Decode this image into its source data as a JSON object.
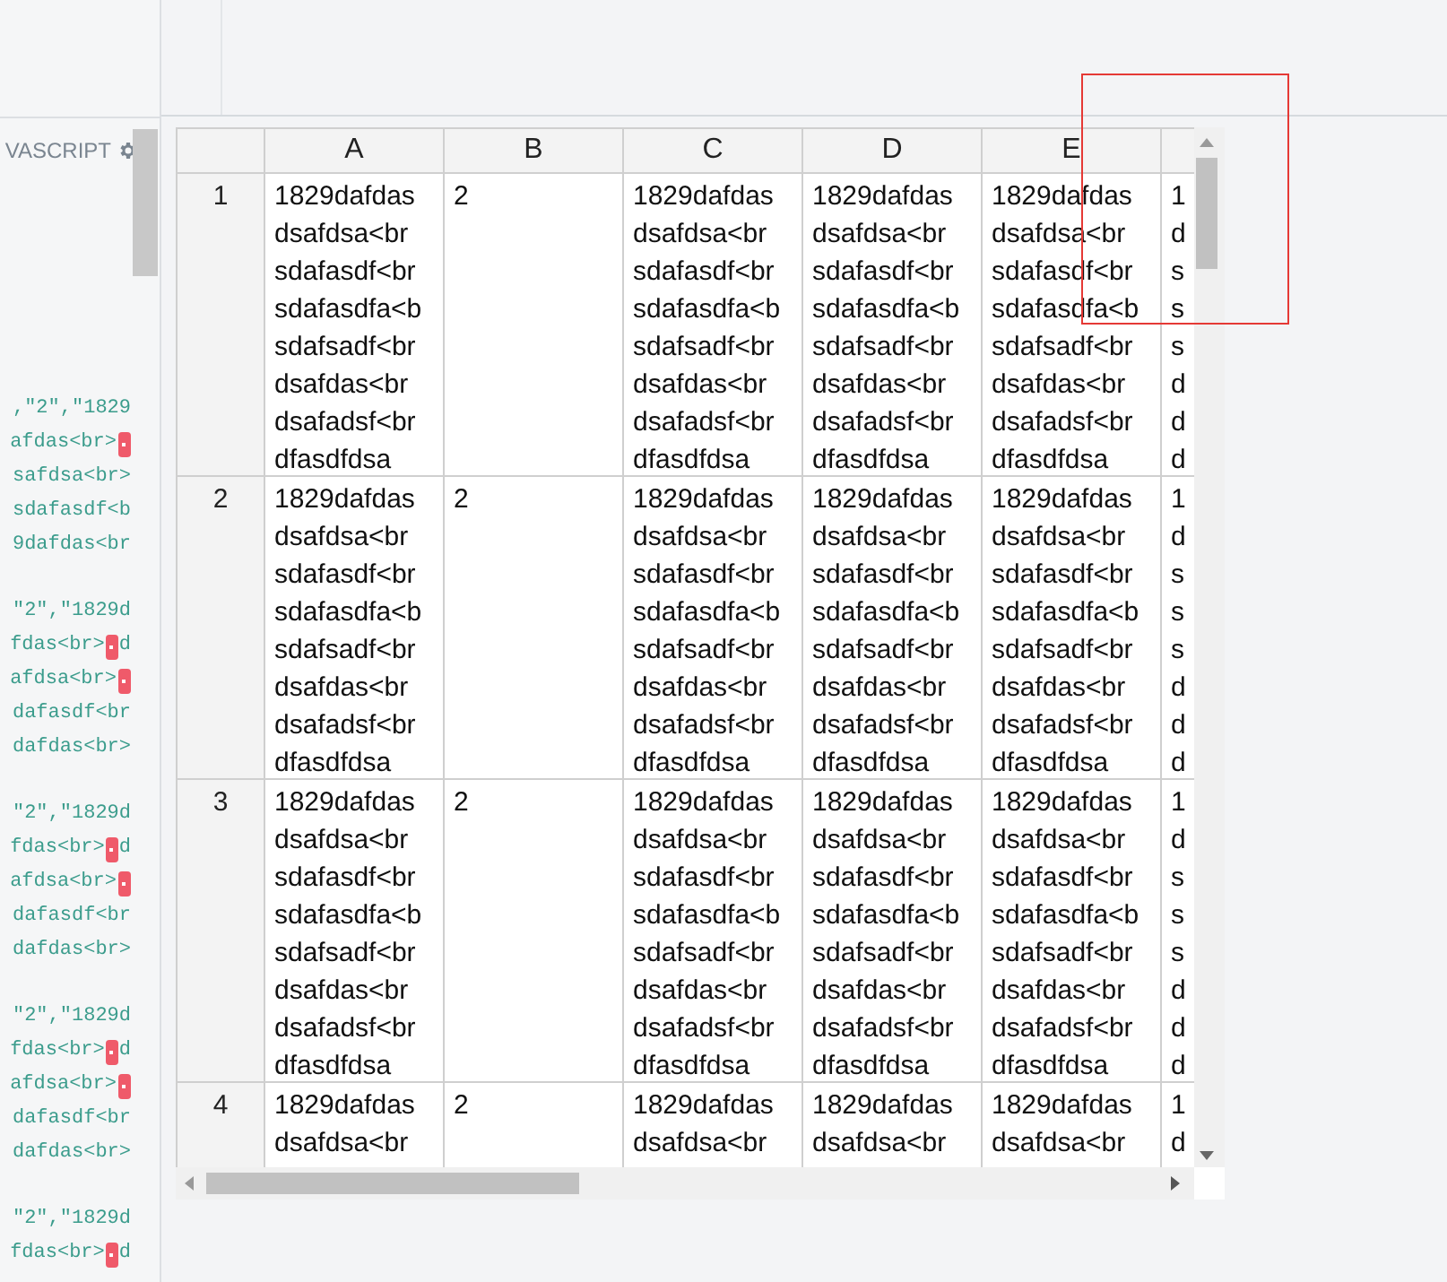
{
  "code_panel": {
    "title": "VASCRIPT",
    "groups": [
      [
        {
          "text": ",\"2\",\"1829",
          "marker": false
        },
        {
          "text": "afdas<br>",
          "marker": true
        },
        {
          "text": "safdsa<br>",
          "marker": false
        },
        {
          "text": "sdafasdf<b",
          "marker": false
        },
        {
          "text": "9dafdas<br",
          "marker": false
        }
      ],
      [
        {
          "text": "\"2\",\"1829d",
          "marker": false
        },
        {
          "text": "fdas<br>",
          "marker": true,
          "tail": "d"
        },
        {
          "text": "afdsa<br>",
          "marker": true
        },
        {
          "text": "dafasdf<br",
          "marker": false
        },
        {
          "text": "dafdas<br>",
          "marker": false
        }
      ],
      [
        {
          "text": "\"2\",\"1829d",
          "marker": false
        },
        {
          "text": "fdas<br>",
          "marker": true,
          "tail": "d"
        },
        {
          "text": "afdsa<br>",
          "marker": true
        },
        {
          "text": "dafasdf<br",
          "marker": false
        },
        {
          "text": "dafdas<br>",
          "marker": false
        }
      ],
      [
        {
          "text": "\"2\",\"1829d",
          "marker": false
        },
        {
          "text": "fdas<br>",
          "marker": true,
          "tail": "d"
        },
        {
          "text": "afdsa<br>",
          "marker": true
        },
        {
          "text": "dafasdf<br",
          "marker": false
        },
        {
          "text": "dafdas<br>",
          "marker": false
        }
      ],
      [
        {
          "text": "\"2\",\"1829d",
          "marker": false
        },
        {
          "text": "fdas<br>",
          "marker": true,
          "tail": "d"
        }
      ]
    ]
  },
  "sheet": {
    "columns": [
      "A",
      "B",
      "C",
      "D",
      "E"
    ],
    "rows": [
      {
        "header": "1",
        "cells": [
          [
            "1829dafdas",
            "dsafdsa<br",
            "sdafasdf<br",
            "sdafasdfa<b",
            "sdafsadf<br",
            "dsafdas<br",
            "dsafadsf<br",
            "dfasdfdsa"
          ],
          [
            "2"
          ],
          [
            "1829dafdas",
            "dsafdsa<br",
            "sdafasdf<br",
            "sdafasdfa<b",
            "sdafsadf<br",
            "dsafdas<br",
            "dsafadsf<br",
            "dfasdfdsa"
          ],
          [
            "1829dafdas",
            "dsafdsa<br",
            "sdafasdf<br",
            "sdafasdfa<b",
            "sdafsadf<br",
            "dsafdas<br",
            "dsafadsf<br",
            "dfasdfdsa"
          ],
          [
            "1829dafdas",
            "dsafdsa<br",
            "sdafasdf<br",
            "sdafasdfa<b",
            "sdafsadf<br",
            "dsafdas<br",
            "dsafadsf<br",
            "dfasdfdsa"
          ],
          [
            "1",
            "d",
            "s",
            "s",
            "s",
            "d",
            "d",
            "d"
          ]
        ]
      },
      {
        "header": "2",
        "cells": [
          [
            "1829dafdas",
            "dsafdsa<br",
            "sdafasdf<br",
            "sdafasdfa<b",
            "sdafsadf<br",
            "dsafdas<br",
            "dsafadsf<br",
            "dfasdfdsa"
          ],
          [
            "2"
          ],
          [
            "1829dafdas",
            "dsafdsa<br",
            "sdafasdf<br",
            "sdafasdfa<b",
            "sdafsadf<br",
            "dsafdas<br",
            "dsafadsf<br",
            "dfasdfdsa"
          ],
          [
            "1829dafdas",
            "dsafdsa<br",
            "sdafasdf<br",
            "sdafasdfa<b",
            "sdafsadf<br",
            "dsafdas<br",
            "dsafadsf<br",
            "dfasdfdsa"
          ],
          [
            "1829dafdas",
            "dsafdsa<br",
            "sdafasdf<br",
            "sdafasdfa<b",
            "sdafsadf<br",
            "dsafdas<br",
            "dsafadsf<br",
            "dfasdfdsa"
          ],
          [
            "1",
            "d",
            "s",
            "s",
            "s",
            "d",
            "d",
            "d"
          ]
        ]
      },
      {
        "header": "3",
        "cells": [
          [
            "1829dafdas",
            "dsafdsa<br",
            "sdafasdf<br",
            "sdafasdfa<b",
            "sdafsadf<br",
            "dsafdas<br",
            "dsafadsf<br",
            "dfasdfdsa"
          ],
          [
            "2"
          ],
          [
            "1829dafdas",
            "dsafdsa<br",
            "sdafasdf<br",
            "sdafasdfa<b",
            "sdafsadf<br",
            "dsafdas<br",
            "dsafadsf<br",
            "dfasdfdsa"
          ],
          [
            "1829dafdas",
            "dsafdsa<br",
            "sdafasdf<br",
            "sdafasdfa<b",
            "sdafsadf<br",
            "dsafdas<br",
            "dsafadsf<br",
            "dfasdfdsa"
          ],
          [
            "1829dafdas",
            "dsafdsa<br",
            "sdafasdf<br",
            "sdafasdfa<b",
            "sdafsadf<br",
            "dsafdas<br",
            "dsafadsf<br",
            "dfasdfdsa"
          ],
          [
            "1",
            "d",
            "s",
            "s",
            "s",
            "d",
            "d",
            "d"
          ]
        ]
      },
      {
        "header": "4",
        "cells": [
          [
            "1829dafdas",
            "dsafdsa<br"
          ],
          [
            "2"
          ],
          [
            "1829dafdas",
            "dsafdsa<br"
          ],
          [
            "1829dafdas",
            "dsafdsa<br"
          ],
          [
            "1829dafdas",
            "dsafdsa<br"
          ],
          [
            "1",
            "d"
          ]
        ]
      }
    ]
  }
}
